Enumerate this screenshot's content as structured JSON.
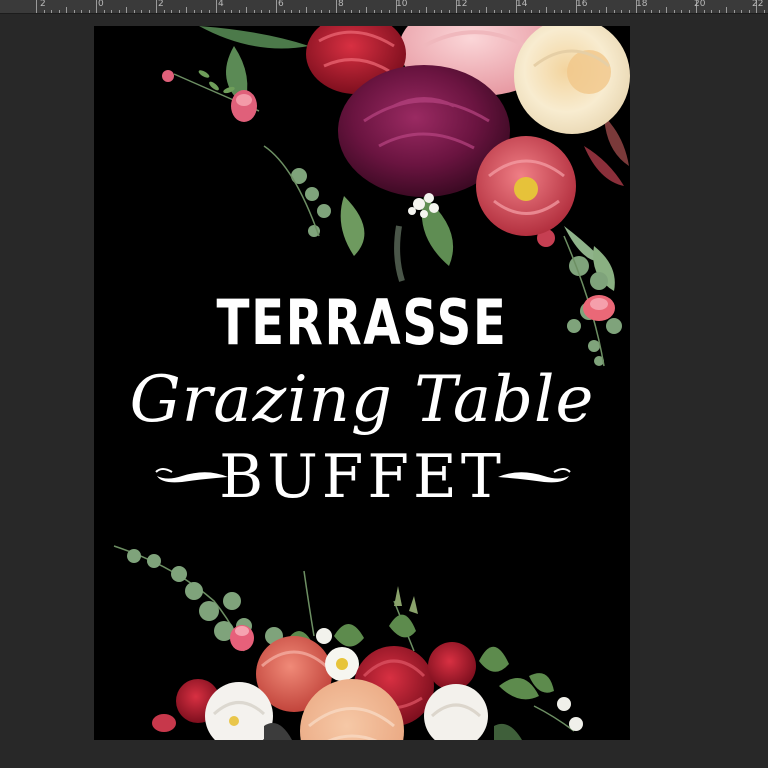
{
  "ruler": {
    "labels": [
      "2",
      "0",
      "2",
      "4",
      "6",
      "8",
      "10",
      "12",
      "14",
      "16",
      "18",
      "20",
      "22"
    ]
  },
  "document": {
    "heading": "TERRASSE",
    "script_line": "Grazing Table",
    "subheading": "BUFFET"
  },
  "colors": {
    "workspace": "#282828",
    "ruler": "#3a3a3a",
    "canvas": "#000000",
    "text": "#ffffff"
  },
  "icons": [
    "flourish-left-icon",
    "flourish-right-icon"
  ]
}
